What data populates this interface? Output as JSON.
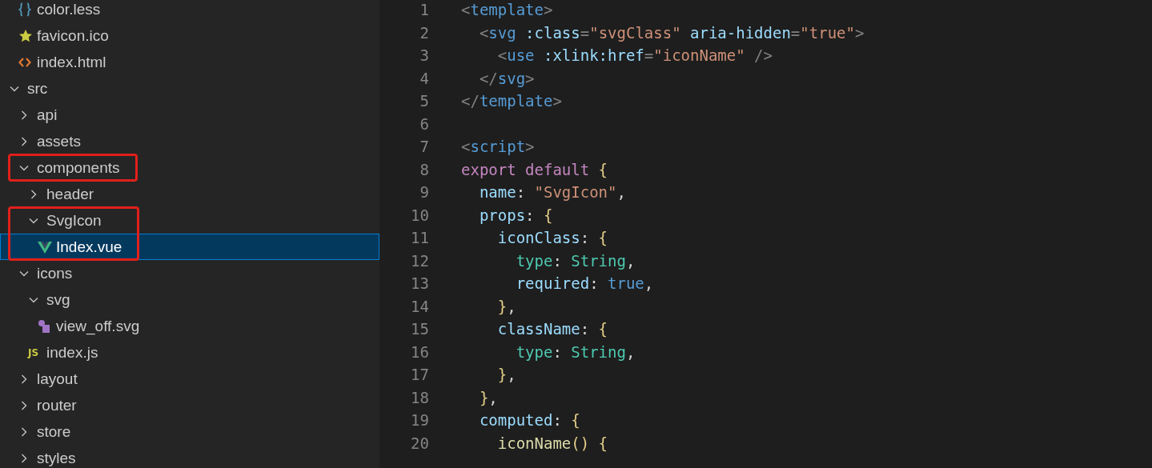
{
  "explorer": {
    "hidden_folder_items": [
      {
        "name": "color.less",
        "kind": "stylesheet",
        "selected": false,
        "outlined": false
      },
      {
        "name": "favicon.ico",
        "kind": "favicon",
        "selected": false,
        "outlined": false
      },
      {
        "name": "index.html",
        "kind": "markup",
        "selected": false,
        "outlined": false
      }
    ],
    "tree": [
      {
        "name": "src",
        "kind": "folder",
        "expanded": true,
        "selected": false,
        "outlined": false,
        "children": [
          {
            "name": "api",
            "kind": "folder",
            "expanded": false,
            "selected": false,
            "outlined": false
          },
          {
            "name": "assets",
            "kind": "folder",
            "expanded": false,
            "selected": false,
            "outlined": false
          },
          {
            "name": "components",
            "kind": "folder",
            "expanded": true,
            "selected": false,
            "outlined": true,
            "children": [
              {
                "name": "header",
                "kind": "folder",
                "expanded": false,
                "selected": false,
                "outlined": false
              },
              {
                "name": "SvgIcon",
                "kind": "folder",
                "expanded": true,
                "selected": false,
                "outlined": true,
                "children": [
                  {
                    "name": "Index.vue",
                    "kind": "component",
                    "selected": true,
                    "outlined": true
                  }
                ]
              }
            ]
          },
          {
            "name": "icons",
            "kind": "folder",
            "expanded": true,
            "selected": false,
            "outlined": false,
            "children": [
              {
                "name": "svg",
                "kind": "folder",
                "expanded": true,
                "selected": false,
                "outlined": false,
                "children": [
                  {
                    "name": "view_off.svg",
                    "kind": "vector",
                    "selected": false,
                    "outlined": false
                  }
                ]
              },
              {
                "name": "index.js",
                "kind": "script",
                "icon_text": "JS",
                "selected": false,
                "outlined": false
              }
            ]
          },
          {
            "name": "layout",
            "kind": "folder",
            "expanded": false,
            "selected": false,
            "outlined": false
          },
          {
            "name": "router",
            "kind": "folder",
            "expanded": false,
            "selected": false,
            "outlined": false
          },
          {
            "name": "store",
            "kind": "folder",
            "expanded": false,
            "selected": false,
            "outlined": false
          },
          {
            "name": "styles",
            "kind": "folder",
            "expanded": false,
            "selected": false,
            "outlined": false
          }
        ]
      }
    ]
  },
  "editor": {
    "lines": [
      {
        "number": "1",
        "tokens": [
          {
            "text": "<",
            "kind": "punct"
          },
          {
            "text": "template",
            "kind": "tag"
          },
          {
            "text": ">",
            "kind": "punct"
          }
        ]
      },
      {
        "number": "2",
        "tokens": [
          {
            "text": "  <",
            "kind": "punct"
          },
          {
            "text": "svg",
            "kind": "tag"
          },
          {
            "text": " :class",
            "kind": "attr"
          },
          {
            "text": "=",
            "kind": "punct"
          },
          {
            "text": "\"svgClass\"",
            "kind": "str"
          },
          {
            "text": " aria-hidden",
            "kind": "attr"
          },
          {
            "text": "=",
            "kind": "punct"
          },
          {
            "text": "\"true\"",
            "kind": "str"
          },
          {
            "text": ">",
            "kind": "punct"
          }
        ]
      },
      {
        "number": "3",
        "tokens": [
          {
            "text": "    <",
            "kind": "punct"
          },
          {
            "text": "use",
            "kind": "tag"
          },
          {
            "text": " :xlink:href",
            "kind": "attr"
          },
          {
            "text": "=",
            "kind": "punct"
          },
          {
            "text": "\"iconName\"",
            "kind": "str"
          },
          {
            "text": " />",
            "kind": "punct"
          }
        ]
      },
      {
        "number": "4",
        "tokens": [
          {
            "text": "  </",
            "kind": "punct"
          },
          {
            "text": "svg",
            "kind": "tag"
          },
          {
            "text": ">",
            "kind": "punct"
          }
        ]
      },
      {
        "number": "5",
        "tokens": [
          {
            "text": "</",
            "kind": "punct"
          },
          {
            "text": "template",
            "kind": "tag"
          },
          {
            "text": ">",
            "kind": "punct"
          }
        ]
      },
      {
        "number": "6"
      },
      {
        "number": "7",
        "tokens": [
          {
            "text": "<",
            "kind": "punct"
          },
          {
            "text": "script",
            "kind": "tag"
          },
          {
            "text": ">",
            "kind": "punct"
          }
        ]
      },
      {
        "number": "8",
        "tokens": [
          {
            "text": "export default",
            "kind": "kw"
          },
          {
            "text": " {",
            "kind": "brace"
          }
        ]
      },
      {
        "number": "9",
        "tokens": [
          {
            "text": "  name",
            "kind": "prop"
          },
          {
            "text": ": ",
            "kind": "plain"
          },
          {
            "text": "\"SvgIcon\"",
            "kind": "str"
          },
          {
            "text": ",",
            "kind": "plain"
          }
        ]
      },
      {
        "number": "10",
        "tokens": [
          {
            "text": "  props",
            "kind": "prop"
          },
          {
            "text": ": ",
            "kind": "plain"
          },
          {
            "text": "{",
            "kind": "brace"
          }
        ]
      },
      {
        "number": "11",
        "tokens": [
          {
            "text": "    iconClass",
            "kind": "prop"
          },
          {
            "text": ": ",
            "kind": "plain"
          },
          {
            "text": "{",
            "kind": "brace"
          }
        ]
      },
      {
        "number": "12",
        "tokens": [
          {
            "text": "      type",
            "kind": "type"
          },
          {
            "text": ": ",
            "kind": "plain"
          },
          {
            "text": "String",
            "kind": "type"
          },
          {
            "text": ",",
            "kind": "plain"
          }
        ]
      },
      {
        "number": "13",
        "tokens": [
          {
            "text": "      required",
            "kind": "prop"
          },
          {
            "text": ": ",
            "kind": "plain"
          },
          {
            "text": "true",
            "kind": "bool"
          },
          {
            "text": ",",
            "kind": "plain"
          }
        ]
      },
      {
        "number": "14",
        "tokens": [
          {
            "text": "    }",
            "kind": "brace"
          },
          {
            "text": ",",
            "kind": "plain"
          }
        ]
      },
      {
        "number": "15",
        "tokens": [
          {
            "text": "    className",
            "kind": "prop"
          },
          {
            "text": ": ",
            "kind": "plain"
          },
          {
            "text": "{",
            "kind": "brace"
          }
        ]
      },
      {
        "number": "16",
        "tokens": [
          {
            "text": "      type",
            "kind": "type"
          },
          {
            "text": ": ",
            "kind": "plain"
          },
          {
            "text": "String",
            "kind": "type"
          },
          {
            "text": ",",
            "kind": "plain"
          }
        ]
      },
      {
        "number": "17",
        "tokens": [
          {
            "text": "    }",
            "kind": "brace"
          },
          {
            "text": ",",
            "kind": "plain"
          }
        ]
      },
      {
        "number": "18",
        "tokens": [
          {
            "text": "  }",
            "kind": "brace"
          },
          {
            "text": ",",
            "kind": "plain"
          }
        ]
      },
      {
        "number": "19",
        "tokens": [
          {
            "text": "  computed",
            "kind": "prop"
          },
          {
            "text": ": ",
            "kind": "plain"
          },
          {
            "text": "{",
            "kind": "brace"
          }
        ]
      },
      {
        "number": "20",
        "tokens": [
          {
            "text": "    iconName",
            "kind": "fn"
          },
          {
            "text": "()",
            "kind": "brace"
          },
          {
            "text": " {",
            "kind": "brace"
          }
        ]
      }
    ]
  }
}
